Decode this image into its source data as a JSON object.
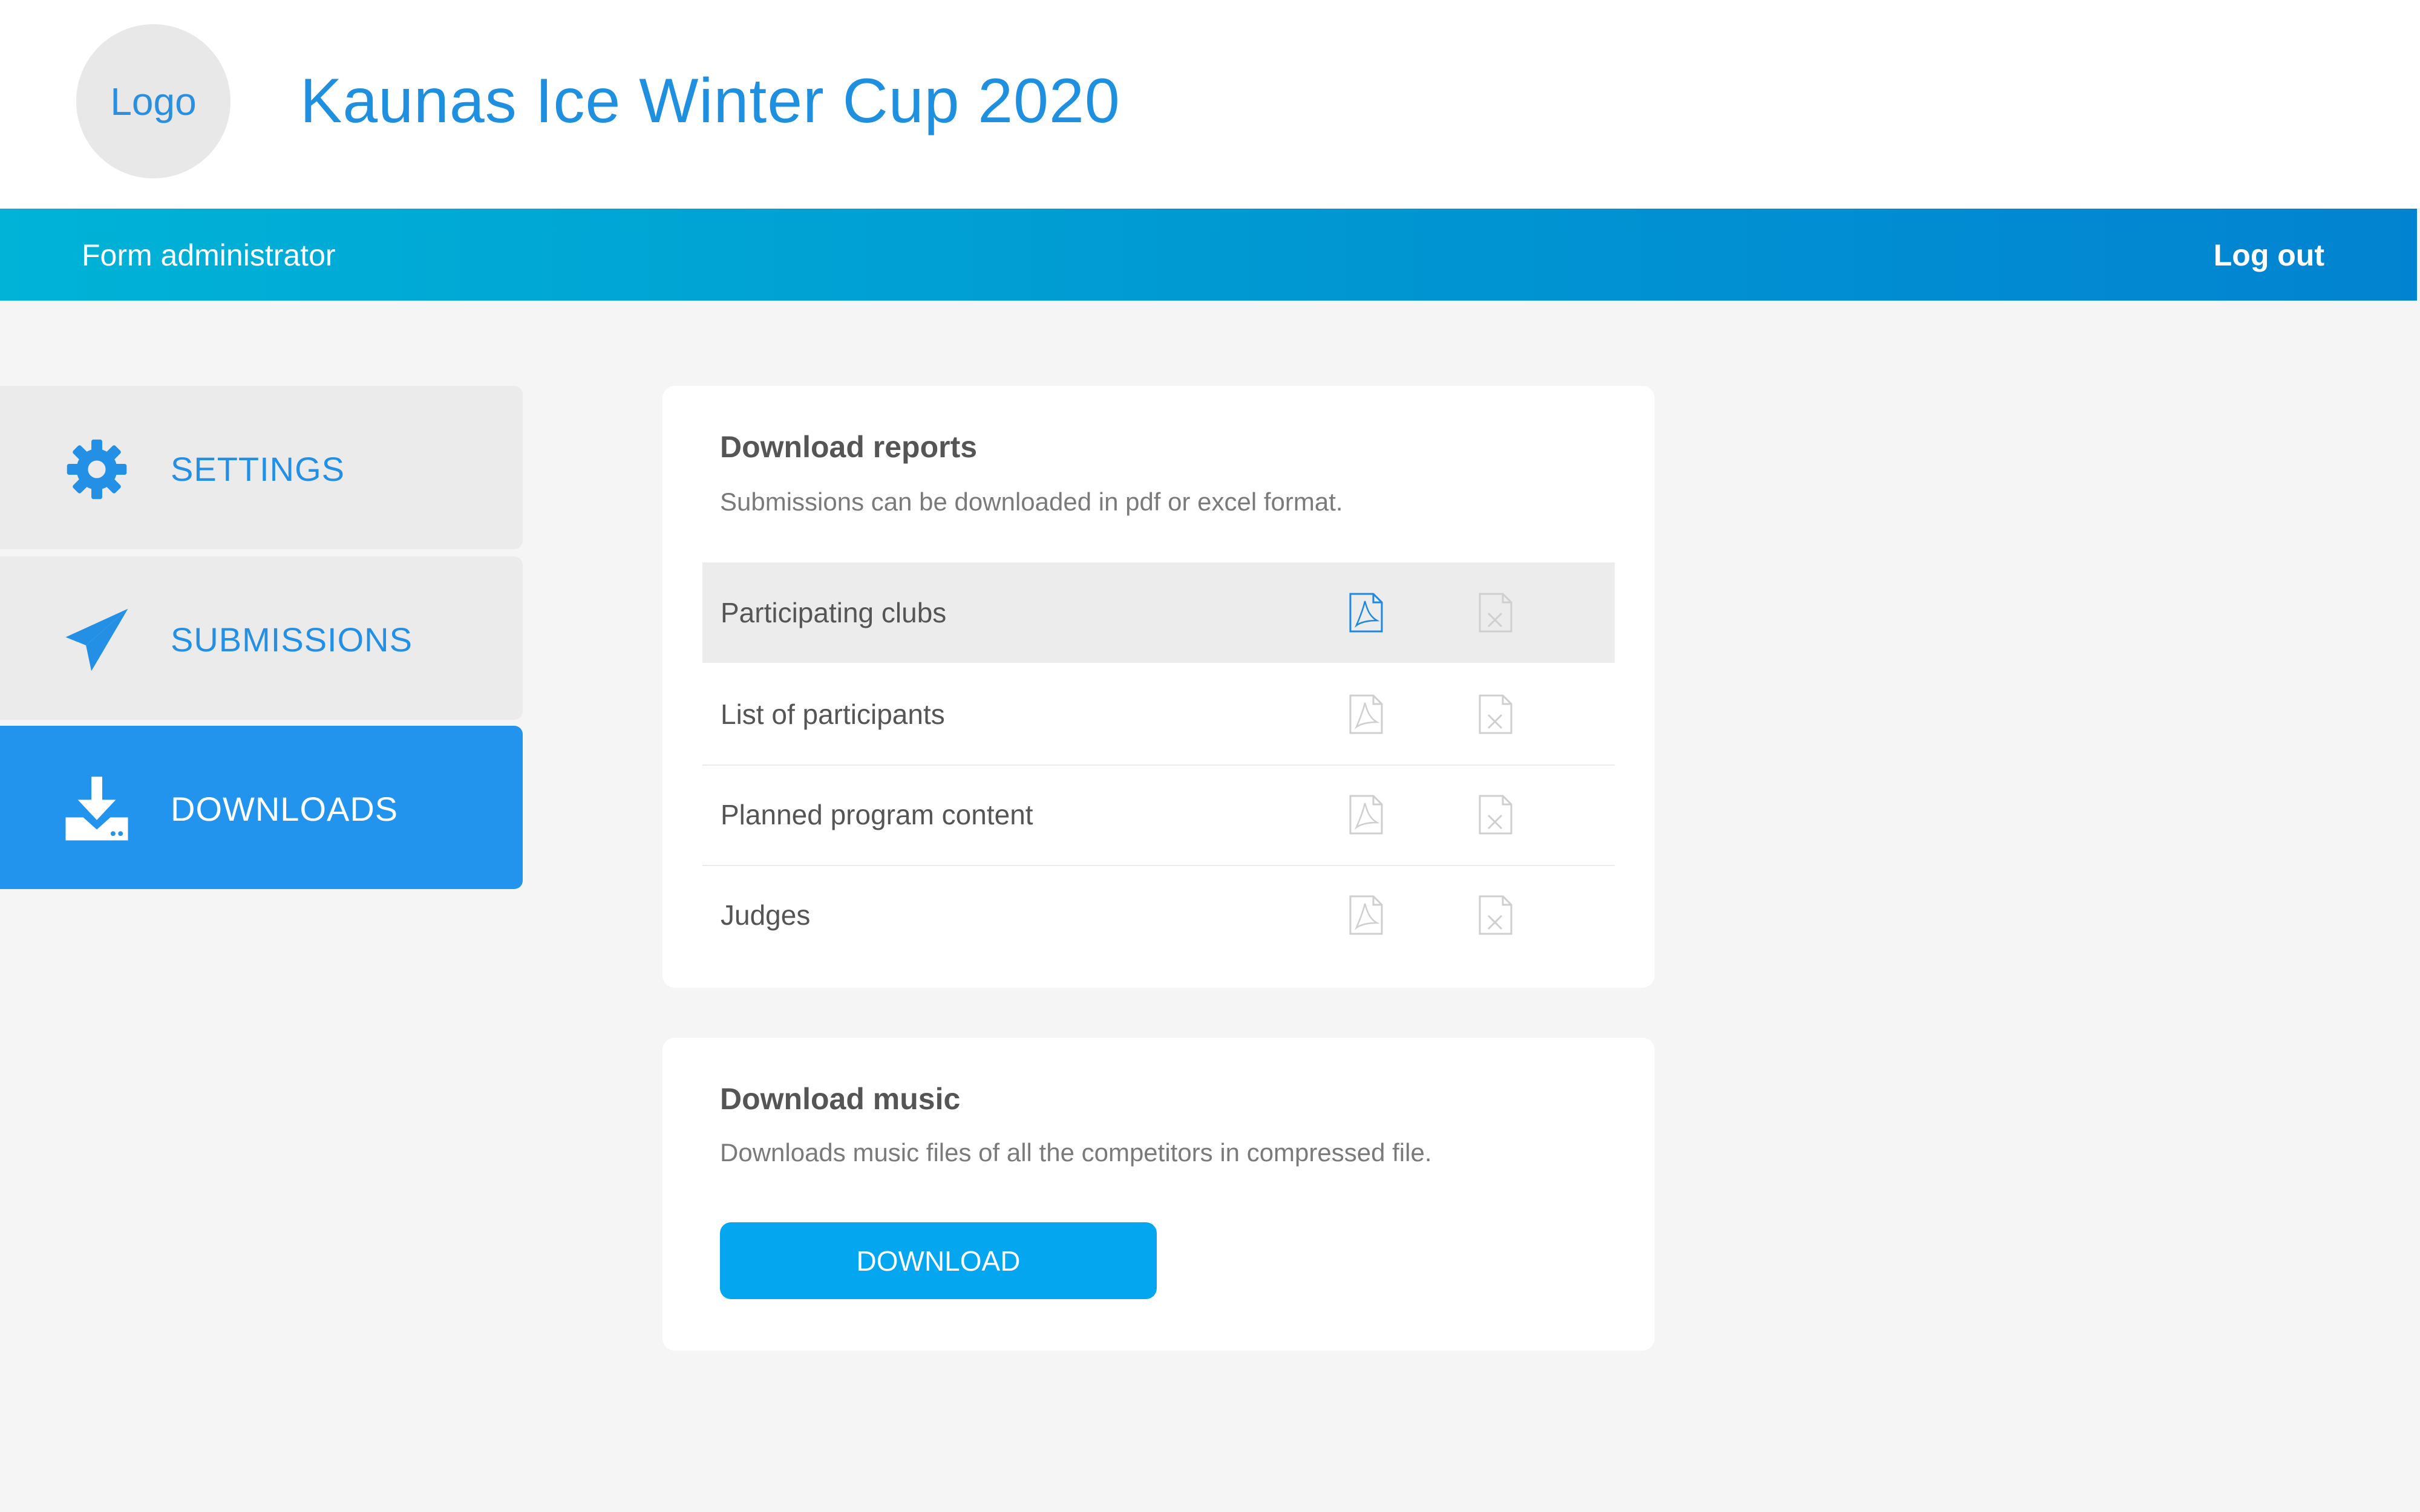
{
  "header": {
    "logo_text": "Logo",
    "title": "Kaunas Ice Winter Cup 2020"
  },
  "navbar": {
    "role": "Form administrator",
    "logout": "Log out"
  },
  "sidebar": {
    "items": [
      {
        "label": "SETTINGS",
        "icon": "gear-icon",
        "active": false
      },
      {
        "label": "SUBMISSIONS",
        "icon": "paper-plane-icon",
        "active": false
      },
      {
        "label": "DOWNLOADS",
        "icon": "download-icon",
        "active": true
      }
    ]
  },
  "reports": {
    "title": "Download reports",
    "subtitle": "Submissions can be downloaded in pdf or excel format.",
    "rows": [
      {
        "label": "Participating clubs",
        "highlighted": true
      },
      {
        "label": "List of participants",
        "highlighted": false
      },
      {
        "label": "Planned program content",
        "highlighted": false
      },
      {
        "label": "Judges",
        "highlighted": false
      }
    ]
  },
  "music": {
    "title": "Download music",
    "subtitle": "Downloads music files of all the competitors in compressed file.",
    "button": "DOWNLOAD"
  },
  "colors": {
    "accent": "#2294ee",
    "nav_start": "#00b3d7",
    "nav_end": "#0283d1",
    "button": "#05a6f0"
  }
}
